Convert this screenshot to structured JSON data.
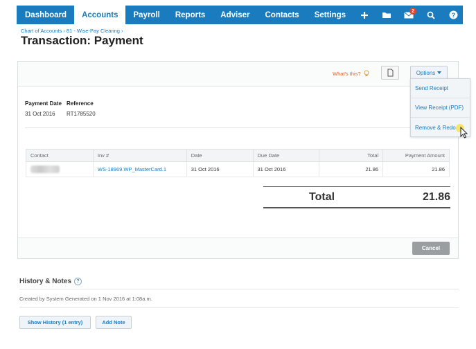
{
  "nav": {
    "tabs": [
      {
        "label": "Dashboard",
        "active": false
      },
      {
        "label": "Accounts",
        "active": true
      },
      {
        "label": "Payroll",
        "active": false
      },
      {
        "label": "Reports",
        "active": false
      },
      {
        "label": "Adviser",
        "active": false
      },
      {
        "label": "Contacts",
        "active": false
      },
      {
        "label": "Settings",
        "active": false
      }
    ],
    "icons": [
      "plus-icon",
      "folder-icon",
      "mail-icon",
      "search-icon",
      "help-icon"
    ],
    "mail_badge": "2",
    "color": "#1a7bbf"
  },
  "breadcrumb": "Chart of Accounts › 81 - Wise-Pay Clearing ›",
  "page_title": "Transaction: Payment",
  "toolbar": {
    "whats_this": "What's this?",
    "options_label": "Options"
  },
  "meta": {
    "payment_date_label": "Payment Date",
    "reference_label": "Reference",
    "payment_date": "31 Oct 2016",
    "reference": "RT1785520"
  },
  "table": {
    "headers": [
      "Contact",
      "Inv #",
      "Date",
      "Due Date",
      "Total",
      "Payment Amount"
    ],
    "rows": [
      {
        "contact": "",
        "invoice": "WS-18969.WP_MasterCard.1",
        "date": "31 Oct 2016",
        "due_date": "31 Oct 2016",
        "total": "21.86",
        "payment_amount": "21.86"
      }
    ]
  },
  "total": {
    "label": "Total",
    "value": "21.86"
  },
  "footer": {
    "cancel_label": "Cancel"
  },
  "options_menu": {
    "items": [
      "Send Receipt",
      "View Receipt (PDF)",
      "Remove & Redo"
    ]
  },
  "history": {
    "title": "History & Notes",
    "help": "?",
    "text": "Created by System Generated on 1 Nov 2016 at 1:08a.m.",
    "show_history_label": "Show History (1 entry)",
    "add_note_label": "Add Note"
  }
}
